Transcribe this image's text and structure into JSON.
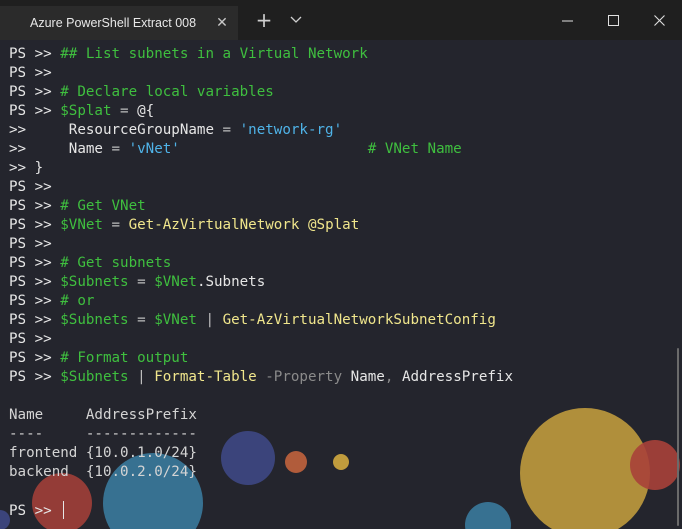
{
  "window": {
    "tab_title": "Azure PowerShell Extract 008",
    "tab_close_icon": "close-icon",
    "new_tab_icon": "plus-icon",
    "dropdown_icon": "chevron-down-icon",
    "minimize_icon": "minimize-icon",
    "maximize_icon": "maximize-icon",
    "close_icon": "close-icon"
  },
  "terminal": {
    "colors": {
      "background": "#24252d",
      "comment": "#3fbf3f",
      "variable": "#3fbf3f",
      "command": "#f0e68c",
      "string": "#4fb3e8",
      "parameter": "#8a8a8a",
      "text": "#e6e6e6"
    },
    "lines": [
      [
        [
          "prompt",
          "PS >> "
        ],
        [
          "comment",
          "## List subnets in a Virtual Network"
        ]
      ],
      [
        [
          "prompt",
          "PS >>"
        ]
      ],
      [
        [
          "prompt",
          "PS >> "
        ],
        [
          "comment",
          "# Declare local variables"
        ]
      ],
      [
        [
          "prompt",
          "PS >> "
        ],
        [
          "var",
          "$Splat"
        ],
        [
          "op",
          " = "
        ],
        [
          "plain",
          "@{"
        ]
      ],
      [
        [
          "prompt",
          ">>     "
        ],
        [
          "plain",
          "ResourceGroupName"
        ],
        [
          "op",
          " = "
        ],
        [
          "str",
          "'network-rg'"
        ]
      ],
      [
        [
          "prompt",
          ">>     "
        ],
        [
          "plain",
          "Name"
        ],
        [
          "op",
          " = "
        ],
        [
          "str",
          "'vNet'"
        ],
        [
          "plain",
          "                      "
        ],
        [
          "comment",
          "# VNet Name"
        ]
      ],
      [
        [
          "prompt",
          ">> "
        ],
        [
          "plain",
          "}"
        ]
      ],
      [
        [
          "prompt",
          "PS >>"
        ]
      ],
      [
        [
          "prompt",
          "PS >> "
        ],
        [
          "comment",
          "# Get VNet"
        ]
      ],
      [
        [
          "prompt",
          "PS >> "
        ],
        [
          "var",
          "$VNet"
        ],
        [
          "op",
          " = "
        ],
        [
          "cmd",
          "Get-AzVirtualNetwork"
        ],
        [
          "plain",
          " "
        ],
        [
          "splat",
          "@Splat"
        ]
      ],
      [
        [
          "prompt",
          "PS >>"
        ]
      ],
      [
        [
          "prompt",
          "PS >> "
        ],
        [
          "comment",
          "# Get subnets"
        ]
      ],
      [
        [
          "prompt",
          "PS >> "
        ],
        [
          "var",
          "$Subnets"
        ],
        [
          "op",
          " = "
        ],
        [
          "var",
          "$VNet"
        ],
        [
          "plain",
          ".Subnets"
        ]
      ],
      [
        [
          "prompt",
          "PS >> "
        ],
        [
          "comment",
          "# or"
        ]
      ],
      [
        [
          "prompt",
          "PS >> "
        ],
        [
          "var",
          "$Subnets"
        ],
        [
          "op",
          " = "
        ],
        [
          "var",
          "$VNet"
        ],
        [
          "op",
          " | "
        ],
        [
          "cmd",
          "Get-AzVirtualNetworkSubnetConfig"
        ]
      ],
      [
        [
          "prompt",
          "PS >>"
        ]
      ],
      [
        [
          "prompt",
          "PS >> "
        ],
        [
          "comment",
          "# Format output"
        ]
      ],
      [
        [
          "prompt",
          "PS >> "
        ],
        [
          "var",
          "$Subnets"
        ],
        [
          "op",
          " | "
        ],
        [
          "cmd",
          "Format-Table"
        ],
        [
          "param",
          " -Property"
        ],
        [
          "plain",
          " Name"
        ],
        [
          "param",
          ","
        ],
        [
          "plain",
          " AddressPrefix"
        ]
      ],
      [],
      [
        [
          "out",
          "Name     AddressPrefix"
        ]
      ],
      [
        [
          "out",
          "----     -------------"
        ]
      ],
      [
        [
          "out",
          "frontend {10.0.1.0/24}"
        ]
      ],
      [
        [
          "out",
          "backend  {10.0.2.0/24}"
        ]
      ],
      [],
      [
        [
          "prompt",
          "PS >> "
        ]
      ]
    ]
  }
}
